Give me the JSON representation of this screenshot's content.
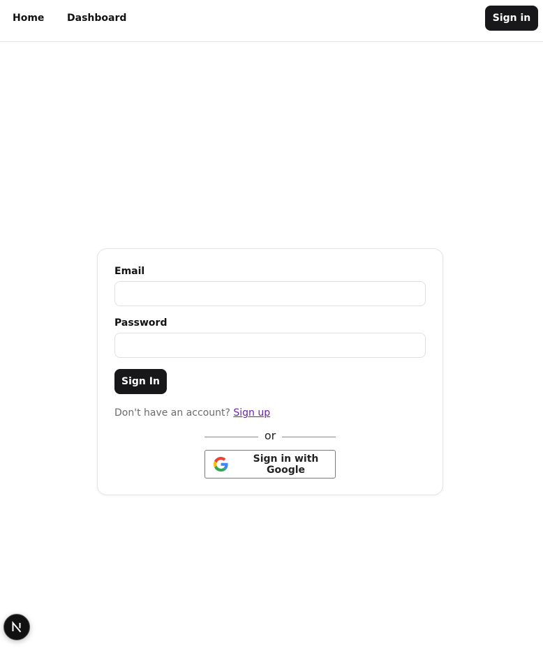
{
  "nav": {
    "home_label": "Home",
    "dashboard_label": "Dashboard",
    "signin_label": "Sign in"
  },
  "form": {
    "email_label": "Email",
    "email_value": "",
    "password_label": "Password",
    "password_value": "",
    "submit_label": "Sign In",
    "signup_prompt": "Don't have an account?",
    "signup_link": "Sign up",
    "divider_text": "or",
    "google_label": "Sign in with Google"
  },
  "badge": {
    "icon": "nextjs-logo-icon"
  },
  "colors": {
    "primary": "#18181b",
    "link": "#6b21a8",
    "muted_text": "#6b6b6b",
    "border": "#e4e4e7"
  }
}
